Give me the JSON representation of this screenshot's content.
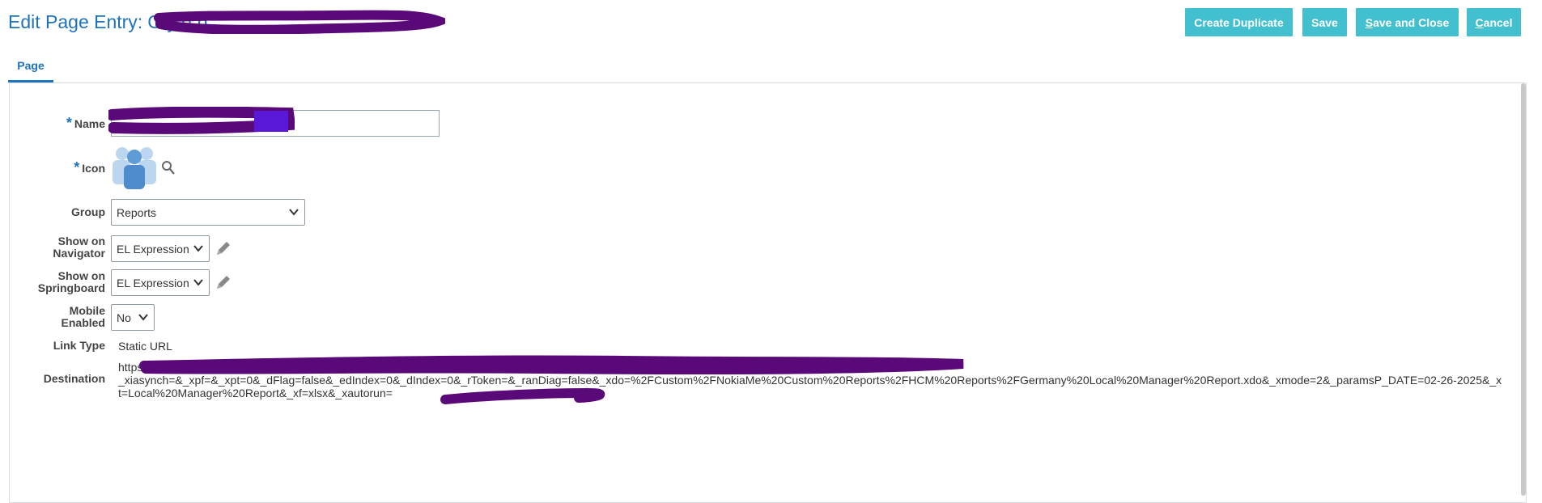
{
  "header": {
    "title_prefix": "Edit Page Entry:",
    "title_name": "G                 y                 g          p"
  },
  "toolbar": {
    "create_duplicate": "Create Duplicate",
    "save": "Save",
    "save_and_close_first": "S",
    "save_and_close_rest": "ave and Close",
    "cancel_first": "C",
    "cancel_rest": "ancel"
  },
  "tabs": [
    {
      "label": "Page",
      "selected": true
    }
  ],
  "form": {
    "name": {
      "label": "Name",
      "required": true,
      "value": ""
    },
    "icon": {
      "label": "Icon",
      "required": true,
      "icon": "people-group-icon"
    },
    "group": {
      "label": "Group",
      "value": "Reports"
    },
    "show_on_navigator": {
      "label_line1": "Show on",
      "label_line2": "Navigator",
      "value": "EL Expression"
    },
    "show_on_springboard": {
      "label_line1": "Show on",
      "label_line2": "Springboard",
      "value": "EL Expression"
    },
    "mobile_enabled": {
      "label_line1": "Mobile",
      "label_line2": "Enabled",
      "value": "No"
    },
    "link_type": {
      "label": "Link Type",
      "value": "Static URL"
    },
    "destination": {
      "label": "Destination",
      "value": "https:/                                                                                                                          anager Re\n_xiasynch=&_xpf=&_xpt=0&_dFlag=false&_edIndex=0&_dIndex=0&_rToken=&_ranDiag=false&_xdo=%2FCustom%2FNokiaMe%20Custom%20Reports%2FHCM%20Reports%2FGermany%20Local%20Manager%20Report.xdo&_xmode=2&_paramsP_DATE=02-26-2025&_xt=Local%20Manager%20Report&_xf=xlsx&_xautorun="
    }
  },
  "colors": {
    "accent": "#1e73be",
    "button": "#43c0d0",
    "redaction": "#5a0a78"
  }
}
